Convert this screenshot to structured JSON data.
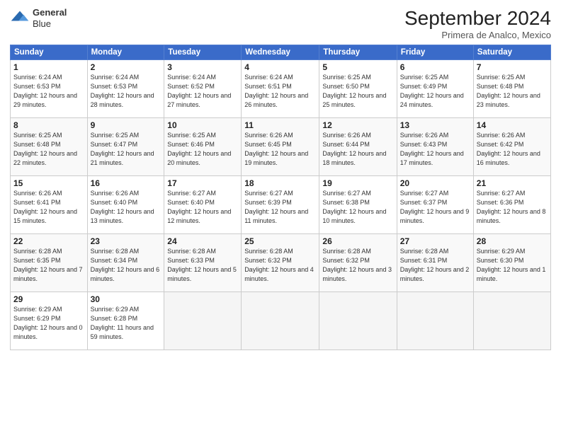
{
  "header": {
    "logo_line1": "General",
    "logo_line2": "Blue",
    "month": "September 2024",
    "location": "Primera de Analco, Mexico"
  },
  "weekdays": [
    "Sunday",
    "Monday",
    "Tuesday",
    "Wednesday",
    "Thursday",
    "Friday",
    "Saturday"
  ],
  "weeks": [
    [
      {
        "day": "1",
        "info": "Sunrise: 6:24 AM\nSunset: 6:53 PM\nDaylight: 12 hours\nand 29 minutes."
      },
      {
        "day": "2",
        "info": "Sunrise: 6:24 AM\nSunset: 6:53 PM\nDaylight: 12 hours\nand 28 minutes."
      },
      {
        "day": "3",
        "info": "Sunrise: 6:24 AM\nSunset: 6:52 PM\nDaylight: 12 hours\nand 27 minutes."
      },
      {
        "day": "4",
        "info": "Sunrise: 6:24 AM\nSunset: 6:51 PM\nDaylight: 12 hours\nand 26 minutes."
      },
      {
        "day": "5",
        "info": "Sunrise: 6:25 AM\nSunset: 6:50 PM\nDaylight: 12 hours\nand 25 minutes."
      },
      {
        "day": "6",
        "info": "Sunrise: 6:25 AM\nSunset: 6:49 PM\nDaylight: 12 hours\nand 24 minutes."
      },
      {
        "day": "7",
        "info": "Sunrise: 6:25 AM\nSunset: 6:48 PM\nDaylight: 12 hours\nand 23 minutes."
      }
    ],
    [
      {
        "day": "8",
        "info": "Sunrise: 6:25 AM\nSunset: 6:48 PM\nDaylight: 12 hours\nand 22 minutes."
      },
      {
        "day": "9",
        "info": "Sunrise: 6:25 AM\nSunset: 6:47 PM\nDaylight: 12 hours\nand 21 minutes."
      },
      {
        "day": "10",
        "info": "Sunrise: 6:25 AM\nSunset: 6:46 PM\nDaylight: 12 hours\nand 20 minutes."
      },
      {
        "day": "11",
        "info": "Sunrise: 6:26 AM\nSunset: 6:45 PM\nDaylight: 12 hours\nand 19 minutes."
      },
      {
        "day": "12",
        "info": "Sunrise: 6:26 AM\nSunset: 6:44 PM\nDaylight: 12 hours\nand 18 minutes."
      },
      {
        "day": "13",
        "info": "Sunrise: 6:26 AM\nSunset: 6:43 PM\nDaylight: 12 hours\nand 17 minutes."
      },
      {
        "day": "14",
        "info": "Sunrise: 6:26 AM\nSunset: 6:42 PM\nDaylight: 12 hours\nand 16 minutes."
      }
    ],
    [
      {
        "day": "15",
        "info": "Sunrise: 6:26 AM\nSunset: 6:41 PM\nDaylight: 12 hours\nand 15 minutes."
      },
      {
        "day": "16",
        "info": "Sunrise: 6:26 AM\nSunset: 6:40 PM\nDaylight: 12 hours\nand 13 minutes."
      },
      {
        "day": "17",
        "info": "Sunrise: 6:27 AM\nSunset: 6:40 PM\nDaylight: 12 hours\nand 12 minutes."
      },
      {
        "day": "18",
        "info": "Sunrise: 6:27 AM\nSunset: 6:39 PM\nDaylight: 12 hours\nand 11 minutes."
      },
      {
        "day": "19",
        "info": "Sunrise: 6:27 AM\nSunset: 6:38 PM\nDaylight: 12 hours\nand 10 minutes."
      },
      {
        "day": "20",
        "info": "Sunrise: 6:27 AM\nSunset: 6:37 PM\nDaylight: 12 hours\nand 9 minutes."
      },
      {
        "day": "21",
        "info": "Sunrise: 6:27 AM\nSunset: 6:36 PM\nDaylight: 12 hours\nand 8 minutes."
      }
    ],
    [
      {
        "day": "22",
        "info": "Sunrise: 6:28 AM\nSunset: 6:35 PM\nDaylight: 12 hours\nand 7 minutes."
      },
      {
        "day": "23",
        "info": "Sunrise: 6:28 AM\nSunset: 6:34 PM\nDaylight: 12 hours\nand 6 minutes."
      },
      {
        "day": "24",
        "info": "Sunrise: 6:28 AM\nSunset: 6:33 PM\nDaylight: 12 hours\nand 5 minutes."
      },
      {
        "day": "25",
        "info": "Sunrise: 6:28 AM\nSunset: 6:32 PM\nDaylight: 12 hours\nand 4 minutes."
      },
      {
        "day": "26",
        "info": "Sunrise: 6:28 AM\nSunset: 6:32 PM\nDaylight: 12 hours\nand 3 minutes."
      },
      {
        "day": "27",
        "info": "Sunrise: 6:28 AM\nSunset: 6:31 PM\nDaylight: 12 hours\nand 2 minutes."
      },
      {
        "day": "28",
        "info": "Sunrise: 6:29 AM\nSunset: 6:30 PM\nDaylight: 12 hours\nand 1 minute."
      }
    ],
    [
      {
        "day": "29",
        "info": "Sunrise: 6:29 AM\nSunset: 6:29 PM\nDaylight: 12 hours\nand 0 minutes."
      },
      {
        "day": "30",
        "info": "Sunrise: 6:29 AM\nSunset: 6:28 PM\nDaylight: 11 hours\nand 59 minutes."
      },
      {
        "day": "",
        "info": ""
      },
      {
        "day": "",
        "info": ""
      },
      {
        "day": "",
        "info": ""
      },
      {
        "day": "",
        "info": ""
      },
      {
        "day": "",
        "info": ""
      }
    ]
  ]
}
